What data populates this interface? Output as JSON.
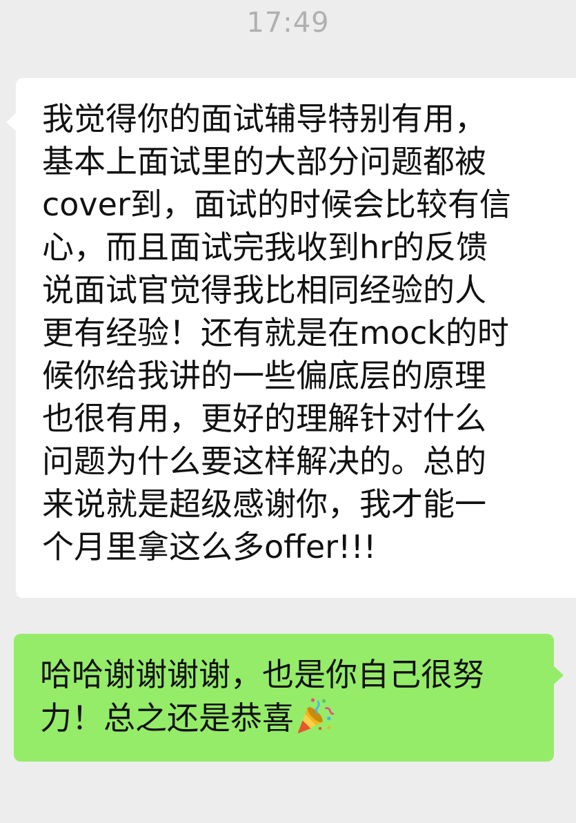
{
  "timestamp": "17:49",
  "messages": [
    {
      "direction": "incoming",
      "bubble_color": "#ffffff",
      "lines": [
        "我觉得你的面试辅导特别有用，",
        "基本上面试里的大部分问题都被",
        "cover到，面试的时候会比较有信",
        "心，而且面试完我收到hr的反馈",
        "说面试官觉得我比相同经验的人",
        "更有经验！还有就是在mock的时",
        "候你给我讲的一些偏底层的原理",
        "也很有用，更好的理解针对什么",
        "问题为什么要这样解决的。总的",
        "来说就是超级感谢你，我才能一",
        "个月里拿这么多offer!!!"
      ]
    },
    {
      "direction": "outgoing",
      "bubble_color": "#95ec69",
      "lines": [
        "哈哈谢谢谢谢，也是你自己很努",
        "力！总之还是恭喜"
      ],
      "trailing_icon": "party-popper-icon"
    }
  ],
  "colors": {
    "background": "#ededed",
    "timestamp": "#b0b0b0",
    "text": "#111111"
  }
}
